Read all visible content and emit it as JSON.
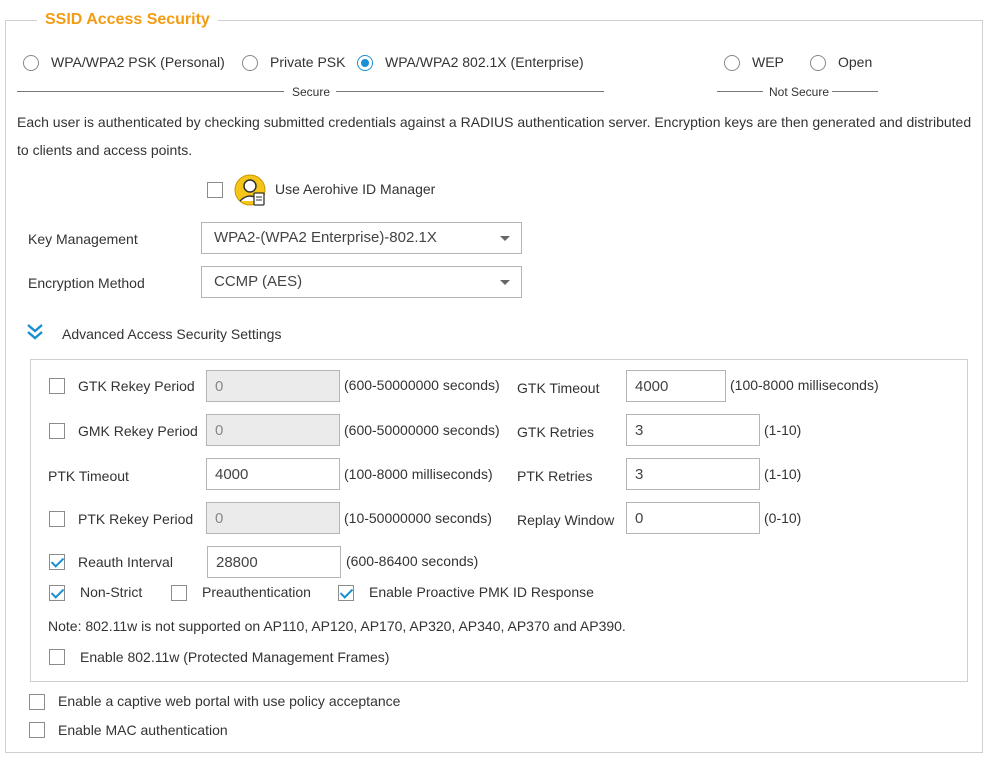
{
  "section": {
    "title": "SSID Access Security"
  },
  "security_options": [
    {
      "label": "WPA/WPA2 PSK (Personal)",
      "selected": false
    },
    {
      "label": "Private PSK",
      "selected": false
    },
    {
      "label": "WPA/WPA2 802.1X (Enterprise)",
      "selected": true
    },
    {
      "label": "WEP",
      "selected": false
    },
    {
      "label": "Open",
      "selected": false
    }
  ],
  "groups": {
    "secure": "Secure",
    "not_secure": "Not Secure"
  },
  "description": {
    "line1": "Each user is authenticated by checking submitted credentials against a RADIUS authentication server. Encryption keys are then generated and distributed",
    "line2": "to clients and access points."
  },
  "id_manager": {
    "label": "Use Aerohive ID Manager",
    "checked": false
  },
  "key_management": {
    "label": "Key Management",
    "value": "WPA2-(WPA2 Enterprise)-802.1X"
  },
  "encryption_method": {
    "label": "Encryption Method",
    "value": "CCMP (AES)"
  },
  "advanced": {
    "toggle_label": "Advanced Access Security Settings",
    "gtk_rekey": {
      "label": "GTK Rekey Period",
      "value": "0",
      "hint": "(600-50000000 seconds)",
      "checked": false
    },
    "gmk_rekey": {
      "label": "GMK Rekey Period",
      "value": "0",
      "hint": "(600-50000000 seconds)",
      "checked": false
    },
    "ptk_timeout": {
      "label": "PTK Timeout",
      "value": "4000",
      "hint": "(100-8000 milliseconds)"
    },
    "ptk_rekey": {
      "label": "PTK Rekey Period",
      "value": "0",
      "hint": "(10-50000000 seconds)",
      "checked": false
    },
    "reauth": {
      "label": "Reauth Interval",
      "value": "28800",
      "hint": "(600-86400 seconds)",
      "checked": true
    },
    "gtk_timeout": {
      "label": "GTK Timeout",
      "value": "4000",
      "hint": "(100-8000 milliseconds)"
    },
    "gtk_retries": {
      "label": "GTK Retries",
      "value": "3",
      "hint": "(1-10)"
    },
    "ptk_retries": {
      "label": "PTK Retries",
      "value": "3",
      "hint": "(1-10)"
    },
    "replay_window": {
      "label": "Replay Window",
      "value": "0",
      "hint": "(0-10)"
    },
    "non_strict": {
      "label": "Non-Strict",
      "checked": true
    },
    "preauth": {
      "label": "Preauthentication",
      "checked": false
    },
    "pmk": {
      "label": "Enable Proactive PMK ID Response",
      "checked": true
    },
    "note": "Note: 802.11w is not supported on AP110, AP120, AP170, AP320, AP340, AP370 and AP390.",
    "pmf": {
      "label": "Enable 802.11w (Protected Management Frames)",
      "checked": false
    }
  },
  "captive_portal": {
    "label": "Enable a captive web portal with use policy acceptance",
    "checked": false
  },
  "mac_auth": {
    "label": "Enable MAC authentication",
    "checked": false
  },
  "colors": {
    "accent_orange": "#f39c12",
    "accent_blue": "#1a8fd1"
  },
  "icons": {
    "id_manager": "user-badge-icon",
    "toggle": "double-chevron-down-icon"
  }
}
